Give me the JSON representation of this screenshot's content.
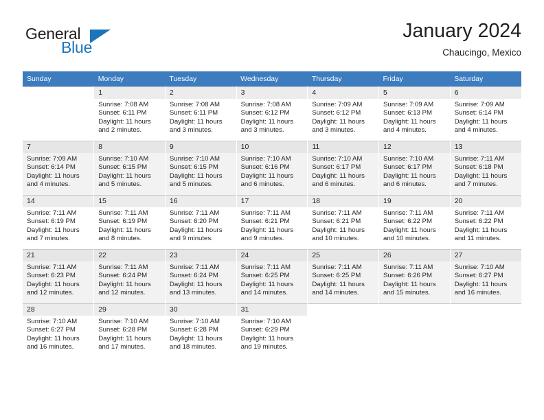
{
  "brand": {
    "name_part1": "General",
    "name_part2": "Blue",
    "logo_icon": "triangle-flag-icon"
  },
  "header": {
    "title": "January 2024",
    "location": "Chaucingo, Mexico"
  },
  "calendar": {
    "weekday_headers": [
      "Sunday",
      "Monday",
      "Tuesday",
      "Wednesday",
      "Thursday",
      "Friday",
      "Saturday"
    ],
    "accent_color": "#3c7cbf",
    "weeks": [
      [
        {
          "day": "",
          "sunrise": "",
          "sunset": "",
          "daylight_line1": "",
          "daylight_line2": ""
        },
        {
          "day": "1",
          "sunrise": "Sunrise: 7:08 AM",
          "sunset": "Sunset: 6:11 PM",
          "daylight_line1": "Daylight: 11 hours",
          "daylight_line2": "and 2 minutes."
        },
        {
          "day": "2",
          "sunrise": "Sunrise: 7:08 AM",
          "sunset": "Sunset: 6:11 PM",
          "daylight_line1": "Daylight: 11 hours",
          "daylight_line2": "and 3 minutes."
        },
        {
          "day": "3",
          "sunrise": "Sunrise: 7:08 AM",
          "sunset": "Sunset: 6:12 PM",
          "daylight_line1": "Daylight: 11 hours",
          "daylight_line2": "and 3 minutes."
        },
        {
          "day": "4",
          "sunrise": "Sunrise: 7:09 AM",
          "sunset": "Sunset: 6:12 PM",
          "daylight_line1": "Daylight: 11 hours",
          "daylight_line2": "and 3 minutes."
        },
        {
          "day": "5",
          "sunrise": "Sunrise: 7:09 AM",
          "sunset": "Sunset: 6:13 PM",
          "daylight_line1": "Daylight: 11 hours",
          "daylight_line2": "and 4 minutes."
        },
        {
          "day": "6",
          "sunrise": "Sunrise: 7:09 AM",
          "sunset": "Sunset: 6:14 PM",
          "daylight_line1": "Daylight: 11 hours",
          "daylight_line2": "and 4 minutes."
        }
      ],
      [
        {
          "day": "7",
          "sunrise": "Sunrise: 7:09 AM",
          "sunset": "Sunset: 6:14 PM",
          "daylight_line1": "Daylight: 11 hours",
          "daylight_line2": "and 4 minutes."
        },
        {
          "day": "8",
          "sunrise": "Sunrise: 7:10 AM",
          "sunset": "Sunset: 6:15 PM",
          "daylight_line1": "Daylight: 11 hours",
          "daylight_line2": "and 5 minutes."
        },
        {
          "day": "9",
          "sunrise": "Sunrise: 7:10 AM",
          "sunset": "Sunset: 6:15 PM",
          "daylight_line1": "Daylight: 11 hours",
          "daylight_line2": "and 5 minutes."
        },
        {
          "day": "10",
          "sunrise": "Sunrise: 7:10 AM",
          "sunset": "Sunset: 6:16 PM",
          "daylight_line1": "Daylight: 11 hours",
          "daylight_line2": "and 6 minutes."
        },
        {
          "day": "11",
          "sunrise": "Sunrise: 7:10 AM",
          "sunset": "Sunset: 6:17 PM",
          "daylight_line1": "Daylight: 11 hours",
          "daylight_line2": "and 6 minutes."
        },
        {
          "day": "12",
          "sunrise": "Sunrise: 7:10 AM",
          "sunset": "Sunset: 6:17 PM",
          "daylight_line1": "Daylight: 11 hours",
          "daylight_line2": "and 6 minutes."
        },
        {
          "day": "13",
          "sunrise": "Sunrise: 7:11 AM",
          "sunset": "Sunset: 6:18 PM",
          "daylight_line1": "Daylight: 11 hours",
          "daylight_line2": "and 7 minutes."
        }
      ],
      [
        {
          "day": "14",
          "sunrise": "Sunrise: 7:11 AM",
          "sunset": "Sunset: 6:19 PM",
          "daylight_line1": "Daylight: 11 hours",
          "daylight_line2": "and 7 minutes."
        },
        {
          "day": "15",
          "sunrise": "Sunrise: 7:11 AM",
          "sunset": "Sunset: 6:19 PM",
          "daylight_line1": "Daylight: 11 hours",
          "daylight_line2": "and 8 minutes."
        },
        {
          "day": "16",
          "sunrise": "Sunrise: 7:11 AM",
          "sunset": "Sunset: 6:20 PM",
          "daylight_line1": "Daylight: 11 hours",
          "daylight_line2": "and 9 minutes."
        },
        {
          "day": "17",
          "sunrise": "Sunrise: 7:11 AM",
          "sunset": "Sunset: 6:21 PM",
          "daylight_line1": "Daylight: 11 hours",
          "daylight_line2": "and 9 minutes."
        },
        {
          "day": "18",
          "sunrise": "Sunrise: 7:11 AM",
          "sunset": "Sunset: 6:21 PM",
          "daylight_line1": "Daylight: 11 hours",
          "daylight_line2": "and 10 minutes."
        },
        {
          "day": "19",
          "sunrise": "Sunrise: 7:11 AM",
          "sunset": "Sunset: 6:22 PM",
          "daylight_line1": "Daylight: 11 hours",
          "daylight_line2": "and 10 minutes."
        },
        {
          "day": "20",
          "sunrise": "Sunrise: 7:11 AM",
          "sunset": "Sunset: 6:22 PM",
          "daylight_line1": "Daylight: 11 hours",
          "daylight_line2": "and 11 minutes."
        }
      ],
      [
        {
          "day": "21",
          "sunrise": "Sunrise: 7:11 AM",
          "sunset": "Sunset: 6:23 PM",
          "daylight_line1": "Daylight: 11 hours",
          "daylight_line2": "and 12 minutes."
        },
        {
          "day": "22",
          "sunrise": "Sunrise: 7:11 AM",
          "sunset": "Sunset: 6:24 PM",
          "daylight_line1": "Daylight: 11 hours",
          "daylight_line2": "and 12 minutes."
        },
        {
          "day": "23",
          "sunrise": "Sunrise: 7:11 AM",
          "sunset": "Sunset: 6:24 PM",
          "daylight_line1": "Daylight: 11 hours",
          "daylight_line2": "and 13 minutes."
        },
        {
          "day": "24",
          "sunrise": "Sunrise: 7:11 AM",
          "sunset": "Sunset: 6:25 PM",
          "daylight_line1": "Daylight: 11 hours",
          "daylight_line2": "and 14 minutes."
        },
        {
          "day": "25",
          "sunrise": "Sunrise: 7:11 AM",
          "sunset": "Sunset: 6:25 PM",
          "daylight_line1": "Daylight: 11 hours",
          "daylight_line2": "and 14 minutes."
        },
        {
          "day": "26",
          "sunrise": "Sunrise: 7:11 AM",
          "sunset": "Sunset: 6:26 PM",
          "daylight_line1": "Daylight: 11 hours",
          "daylight_line2": "and 15 minutes."
        },
        {
          "day": "27",
          "sunrise": "Sunrise: 7:10 AM",
          "sunset": "Sunset: 6:27 PM",
          "daylight_line1": "Daylight: 11 hours",
          "daylight_line2": "and 16 minutes."
        }
      ],
      [
        {
          "day": "28",
          "sunrise": "Sunrise: 7:10 AM",
          "sunset": "Sunset: 6:27 PM",
          "daylight_line1": "Daylight: 11 hours",
          "daylight_line2": "and 16 minutes."
        },
        {
          "day": "29",
          "sunrise": "Sunrise: 7:10 AM",
          "sunset": "Sunset: 6:28 PM",
          "daylight_line1": "Daylight: 11 hours",
          "daylight_line2": "and 17 minutes."
        },
        {
          "day": "30",
          "sunrise": "Sunrise: 7:10 AM",
          "sunset": "Sunset: 6:28 PM",
          "daylight_line1": "Daylight: 11 hours",
          "daylight_line2": "and 18 minutes."
        },
        {
          "day": "31",
          "sunrise": "Sunrise: 7:10 AM",
          "sunset": "Sunset: 6:29 PM",
          "daylight_line1": "Daylight: 11 hours",
          "daylight_line2": "and 19 minutes."
        },
        {
          "day": "",
          "sunrise": "",
          "sunset": "",
          "daylight_line1": "",
          "daylight_line2": ""
        },
        {
          "day": "",
          "sunrise": "",
          "sunset": "",
          "daylight_line1": "",
          "daylight_line2": ""
        },
        {
          "day": "",
          "sunrise": "",
          "sunset": "",
          "daylight_line1": "",
          "daylight_line2": ""
        }
      ]
    ]
  }
}
